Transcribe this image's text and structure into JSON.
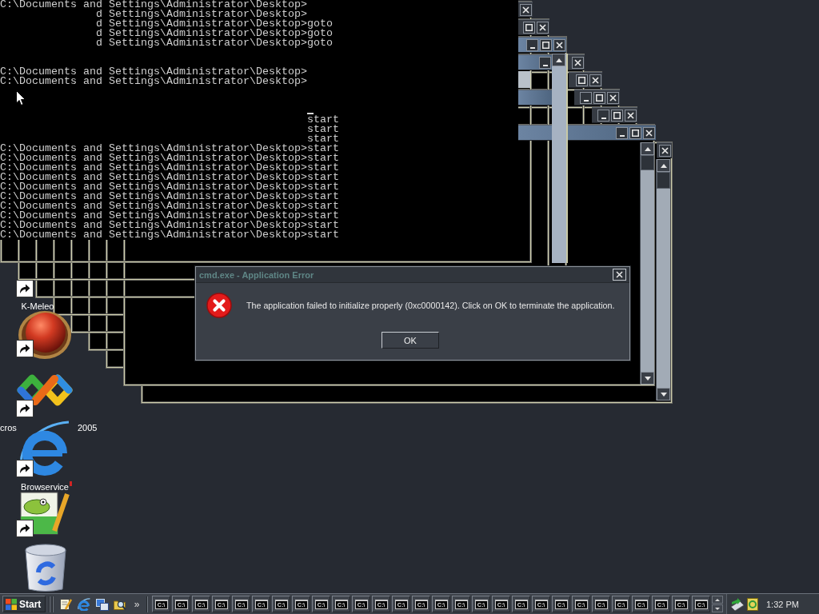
{
  "console": {
    "lines": [
      {
        "kind": "text",
        "text": "C:\\Documents and Settings\\Administrator\\Desktop>"
      },
      {
        "kind": "text",
        "text": "               d Settings\\Administrator\\Desktop>"
      },
      {
        "kind": "text",
        "text": "               d Settings\\Administrator\\Desktop>goto"
      },
      {
        "kind": "text",
        "text": "               d Settings\\Administrator\\Desktop>goto"
      },
      {
        "kind": "text",
        "text": "               d Settings\\Administrator\\Desktop>goto"
      },
      {
        "kind": "blank"
      },
      {
        "kind": "blank"
      },
      {
        "kind": "text",
        "text": "C:\\Documents and Settings\\Administrator\\Desktop>"
      },
      {
        "kind": "text",
        "text": "C:\\Documents and Settings\\Administrator\\Desktop>"
      },
      {
        "kind": "blank"
      },
      {
        "kind": "blank"
      },
      {
        "kind": "cursor"
      },
      {
        "kind": "text",
        "text": "                                                start"
      },
      {
        "kind": "text",
        "text": "                                                start"
      },
      {
        "kind": "text",
        "text": "                                                start"
      },
      {
        "kind": "text",
        "text": "C:\\Documents and Settings\\Administrator\\Desktop>start"
      },
      {
        "kind": "text",
        "text": "C:\\Documents and Settings\\Administrator\\Desktop>start"
      },
      {
        "kind": "text",
        "text": "C:\\Documents and Settings\\Administrator\\Desktop>start"
      },
      {
        "kind": "text",
        "text": "C:\\Documents and Settings\\Administrator\\Desktop>start"
      },
      {
        "kind": "text",
        "text": "C:\\Documents and Settings\\Administrator\\Desktop>start"
      },
      {
        "kind": "text",
        "text": "C:\\Documents and Settings\\Administrator\\Desktop>start"
      },
      {
        "kind": "text",
        "text": "C:\\Documents and Settings\\Administrator\\Desktop>start"
      },
      {
        "kind": "text",
        "text": "C:\\Documents and Settings\\Administrator\\Desktop>start"
      },
      {
        "kind": "text",
        "text": "C:\\Documents and Settings\\Administrator\\Desktop>start"
      },
      {
        "kind": "text",
        "text": "C:\\Documents and Settings\\Administrator\\Desktop>start"
      }
    ]
  },
  "desktop_icons": [
    {
      "shortcut": true,
      "label": "K-Meleo"
    },
    {
      "kind": "ball",
      "shortcut": true
    },
    {
      "kind": "ribbon",
      "shortcut": true,
      "label_parts": [
        "cros",
        "2005"
      ]
    },
    {
      "kind": "browser",
      "shortcut": true,
      "label": "Browservice"
    },
    {
      "kind": "notepad",
      "shortcut": true
    },
    {
      "kind": "trash",
      "shortcut": false
    }
  ],
  "dialog": {
    "title": "cmd.exe - Application Error",
    "message": "The application failed to initialize properly (0xc0000142). Click on OK to terminate the application.",
    "buttons": [
      {
        "label": "OK"
      }
    ]
  },
  "taskbar": {
    "start": "Start",
    "more": "»",
    "windows": [
      {
        "label": "C:\\"
      },
      {
        "label": "C:\\"
      },
      {
        "label": "C:\\"
      },
      {
        "label": "C:\\"
      },
      {
        "label": "C:\\"
      },
      {
        "label": "C:\\"
      },
      {
        "label": "C:\\"
      },
      {
        "label": "C:\\"
      },
      {
        "label": "C:\\"
      },
      {
        "label": "C:\\"
      },
      {
        "label": "C:\\"
      },
      {
        "label": "C:\\"
      },
      {
        "label": "C:\\"
      },
      {
        "label": "C:\\"
      },
      {
        "label": "C:\\"
      },
      {
        "label": "C:\\"
      },
      {
        "label": "C:\\"
      },
      {
        "label": "C:\\"
      },
      {
        "label": "C:\\"
      },
      {
        "label": "C:\\"
      },
      {
        "label": "C:\\"
      },
      {
        "label": "C:\\"
      },
      {
        "label": "C:\\"
      },
      {
        "label": "C:\\"
      },
      {
        "label": "C:\\"
      },
      {
        "label": "C:\\"
      },
      {
        "label": "C:\\"
      },
      {
        "label": "C:\\"
      }
    ],
    "clock": "1:32 PM"
  }
}
